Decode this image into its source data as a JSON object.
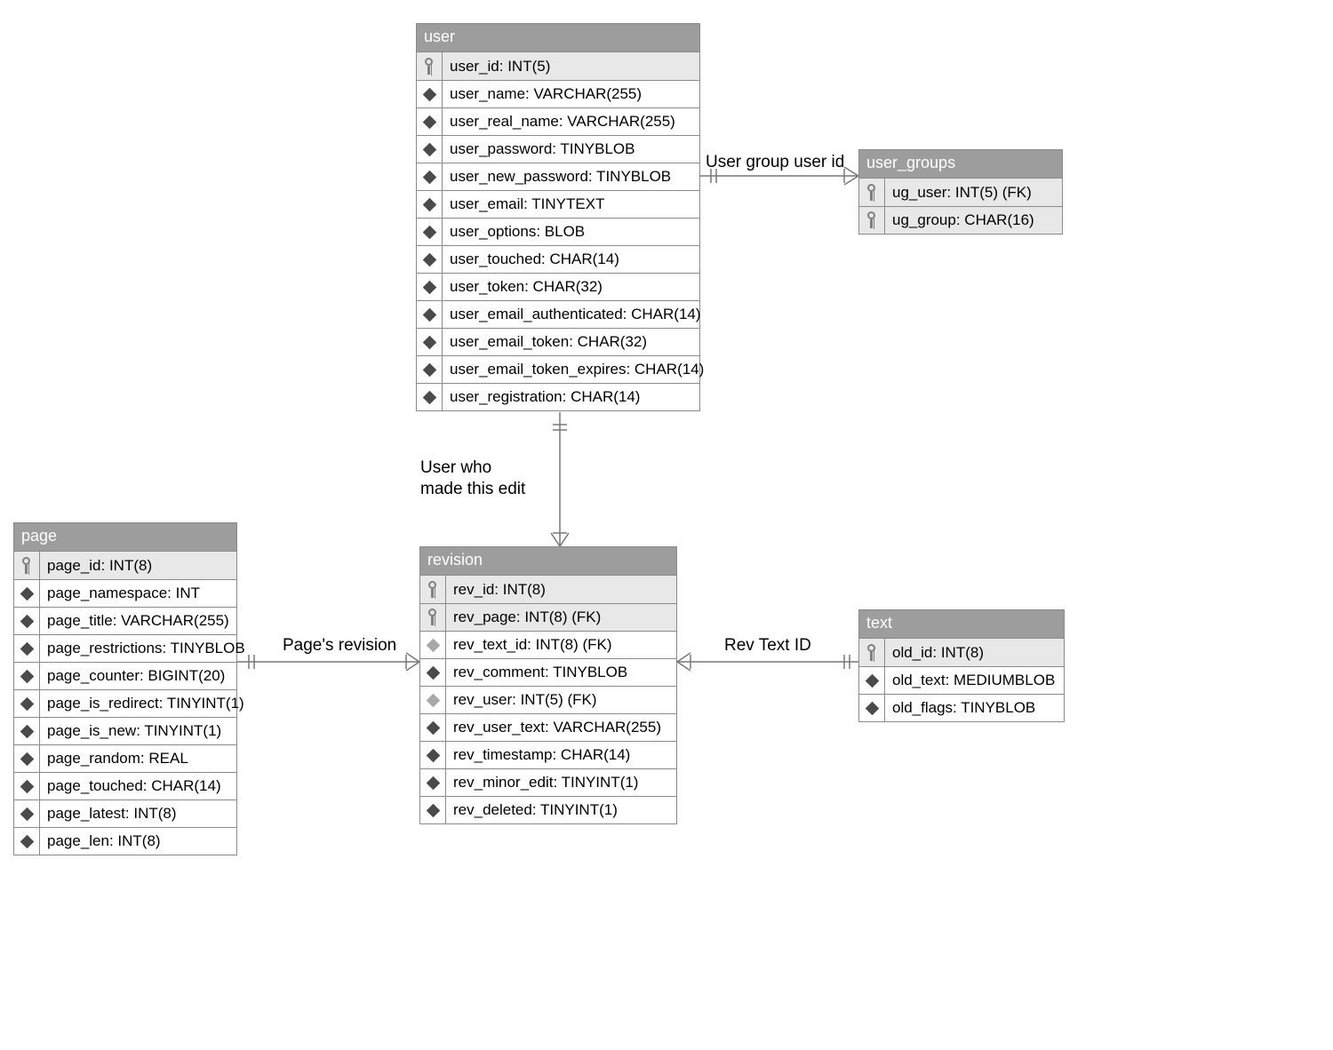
{
  "tables": {
    "user": {
      "title": "user",
      "cols": [
        {
          "icon": "key",
          "pk": true,
          "label": "user_id: INT(5)"
        },
        {
          "icon": "diamond",
          "label": "user_name: VARCHAR(255)"
        },
        {
          "icon": "diamond",
          "label": "user_real_name: VARCHAR(255)"
        },
        {
          "icon": "diamond",
          "label": "user_password: TINYBLOB"
        },
        {
          "icon": "diamond",
          "label": "user_new_password: TINYBLOB"
        },
        {
          "icon": "diamond",
          "label": "user_email: TINYTEXT"
        },
        {
          "icon": "diamond",
          "label": "user_options: BLOB"
        },
        {
          "icon": "diamond",
          "label": "user_touched: CHAR(14)"
        },
        {
          "icon": "diamond",
          "label": "user_token: CHAR(32)"
        },
        {
          "icon": "diamond",
          "label": "user_email_authenticated: CHAR(14)"
        },
        {
          "icon": "diamond",
          "label": "user_email_token: CHAR(32)"
        },
        {
          "icon": "diamond",
          "label": "user_email_token_expires: CHAR(14)"
        },
        {
          "icon": "diamond",
          "label": "user_registration: CHAR(14)"
        }
      ]
    },
    "user_groups": {
      "title": "user_groups",
      "cols": [
        {
          "icon": "key",
          "pk": true,
          "label": "ug_user: INT(5) (FK)"
        },
        {
          "icon": "key",
          "pk": true,
          "label": "ug_group: CHAR(16)"
        }
      ]
    },
    "page": {
      "title": "page",
      "cols": [
        {
          "icon": "key",
          "pk": true,
          "label": "page_id: INT(8)"
        },
        {
          "icon": "diamond",
          "label": "page_namespace: INT"
        },
        {
          "icon": "diamond",
          "label": "page_title: VARCHAR(255)"
        },
        {
          "icon": "diamond",
          "label": "page_restrictions: TINYBLOB"
        },
        {
          "icon": "diamond",
          "label": "page_counter: BIGINT(20)"
        },
        {
          "icon": "diamond",
          "label": "page_is_redirect: TINYINT(1)"
        },
        {
          "icon": "diamond",
          "label": "page_is_new: TINYINT(1)"
        },
        {
          "icon": "diamond",
          "label": "page_random: REAL"
        },
        {
          "icon": "diamond",
          "label": "page_touched: CHAR(14)"
        },
        {
          "icon": "diamond",
          "label": "page_latest: INT(8)"
        },
        {
          "icon": "diamond",
          "label": "page_len: INT(8)"
        }
      ]
    },
    "revision": {
      "title": "revision",
      "cols": [
        {
          "icon": "key",
          "pk": true,
          "label": "rev_id: INT(8)"
        },
        {
          "icon": "key",
          "pk": true,
          "label": "rev_page: INT(8) (FK)"
        },
        {
          "icon": "diamond-light",
          "label": "rev_text_id: INT(8) (FK)"
        },
        {
          "icon": "diamond",
          "label": "rev_comment: TINYBLOB"
        },
        {
          "icon": "diamond-light",
          "label": "rev_user: INT(5) (FK)"
        },
        {
          "icon": "diamond",
          "label": "rev_user_text: VARCHAR(255)"
        },
        {
          "icon": "diamond",
          "label": "rev_timestamp: CHAR(14)"
        },
        {
          "icon": "diamond",
          "label": "rev_minor_edit: TINYINT(1)"
        },
        {
          "icon": "diamond",
          "label": "rev_deleted: TINYINT(1)"
        }
      ]
    },
    "text": {
      "title": "text",
      "cols": [
        {
          "icon": "key",
          "pk": true,
          "label": "old_id: INT(8)"
        },
        {
          "icon": "diamond",
          "label": "old_text: MEDIUMBLOB"
        },
        {
          "icon": "diamond",
          "label": "old_flags: TINYBLOB"
        }
      ]
    }
  },
  "relationships": {
    "user_to_groups": "User group user id",
    "user_to_revision_line1": "User who",
    "user_to_revision_line2": "made this edit",
    "page_to_revision": "Page's revision",
    "revision_to_text": "Rev Text ID"
  }
}
